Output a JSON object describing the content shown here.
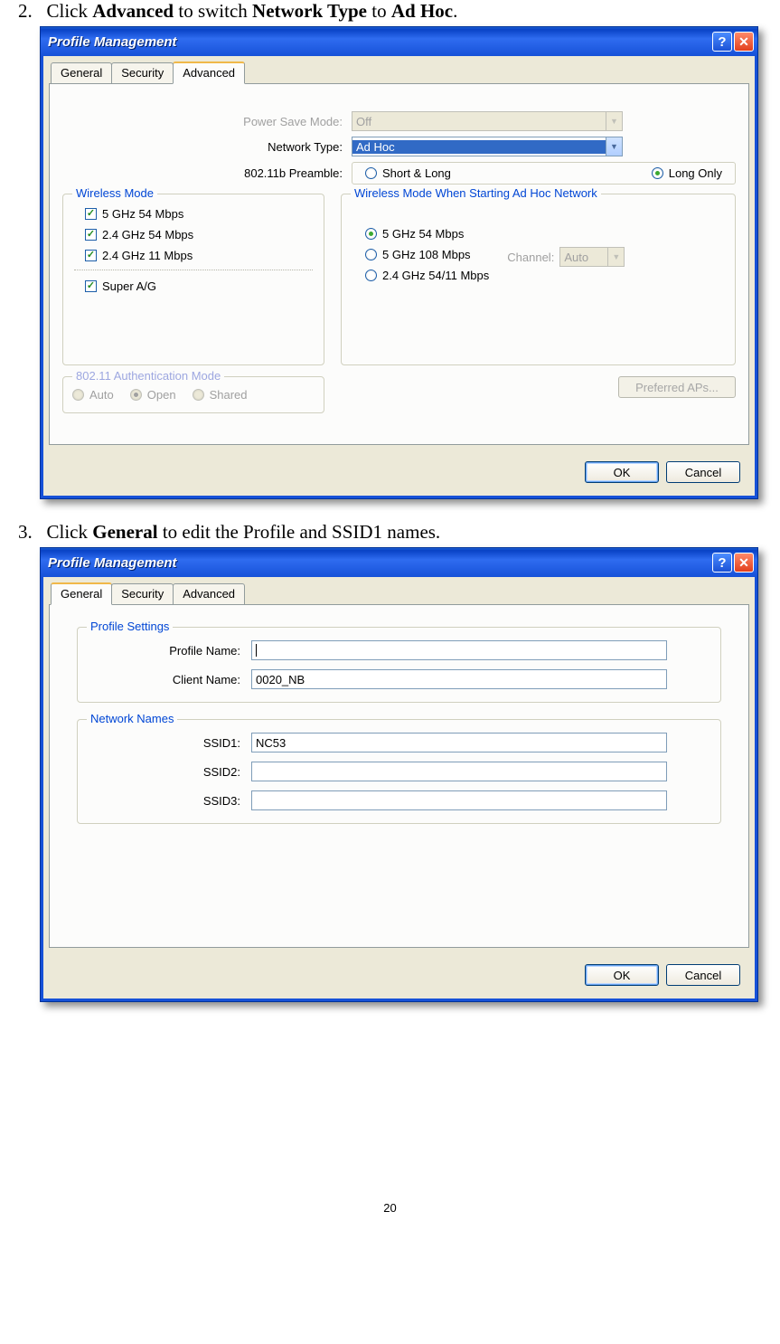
{
  "step2": {
    "num": "2.",
    "text_a": "Click ",
    "text_b": " to switch ",
    "text_c": " to ",
    "bold_advanced": "Advanced",
    "bold_nettype": "Network Type",
    "bold_adhoc": "Ad Hoc",
    "dot": "."
  },
  "step3": {
    "num": "3.",
    "text_a": "Click ",
    "bold_general": "General",
    "text_b": " to edit the Profile and SSID1 names."
  },
  "dlg1": {
    "title": "Profile Management",
    "tabs": {
      "general": "General",
      "security": "Security",
      "advanced": "Advanced"
    },
    "labels": {
      "psm": "Power Save Mode:",
      "nettype": "Network Type:",
      "preamble": "802.11b Preamble:"
    },
    "psm_value": "Off",
    "nettype_value": "Ad Hoc",
    "preamble": {
      "short": "Short & Long",
      "long": "Long Only"
    },
    "group_wireless": "Wireless Mode",
    "wm": {
      "a": "5 GHz 54 Mbps",
      "b": "2.4 GHz 54 Mbps",
      "c": "2.4 GHz 11 Mbps",
      "s": "Super A/G"
    },
    "group_adhoc": "Wireless Mode When Starting Ad Hoc Network",
    "ah": {
      "a": "5 GHz 54 Mbps",
      "b": "5 GHz 108 Mbps",
      "c": "2.4 GHz 54/11 Mbps"
    },
    "channel_lbl": "Channel:",
    "channel_val": "Auto",
    "group_auth": "802.11 Authentication Mode",
    "auth": {
      "auto": "Auto",
      "open": "Open",
      "shared": "Shared"
    },
    "pref_aps": "Preferred APs...",
    "ok": "OK",
    "cancel": "Cancel"
  },
  "dlg2": {
    "title": "Profile Management",
    "tabs": {
      "general": "General",
      "security": "Security",
      "advanced": "Advanced"
    },
    "group_profile": "Profile Settings",
    "profile_name_lbl": "Profile Name:",
    "profile_name_val": "",
    "client_name_lbl": "Client Name:",
    "client_name_val": "0020_NB",
    "group_network": "Network Names",
    "ssid1_lbl": "SSID1:",
    "ssid1_val": "NC53",
    "ssid2_lbl": "SSID2:",
    "ssid2_val": "",
    "ssid3_lbl": "SSID3:",
    "ssid3_val": "",
    "ok": "OK",
    "cancel": "Cancel"
  },
  "page_num": "20"
}
